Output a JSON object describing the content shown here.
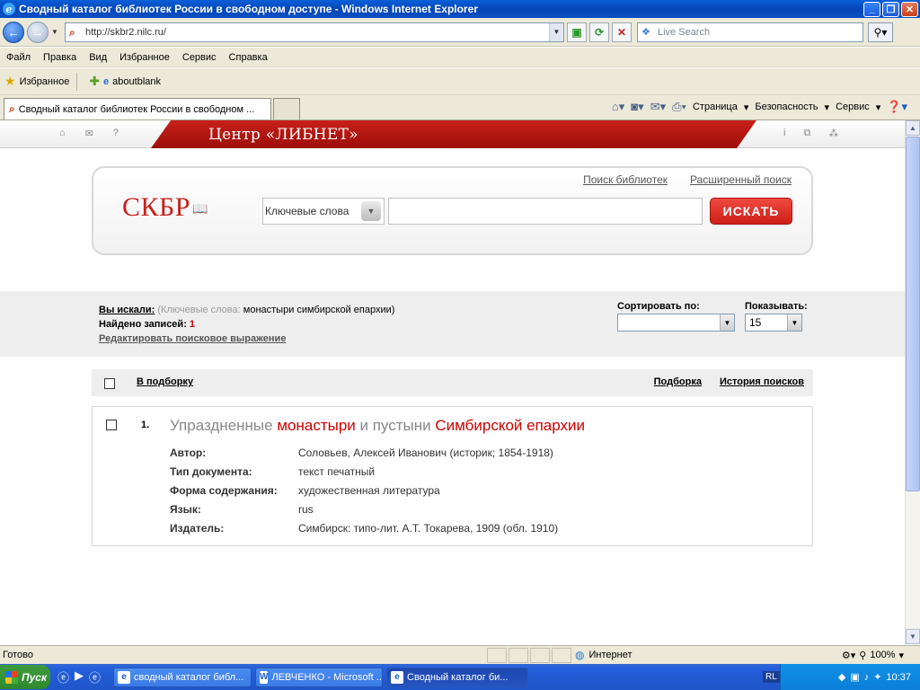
{
  "window": {
    "title": "Сводный каталог библиотек России в свободном доступе - Windows Internet Explorer"
  },
  "address": {
    "url": "http://skbr2.nilc.ru/",
    "search_placeholder": "Live Search"
  },
  "menu": [
    "Файл",
    "Правка",
    "Вид",
    "Избранное",
    "Сервис",
    "Справка"
  ],
  "favorites": {
    "label": "Избранное",
    "link": "aboutblank"
  },
  "tabs": {
    "active": "Сводный каталог библиотек России в свободном ...",
    "commands": [
      "Страница",
      "Безопасность",
      "Сервис"
    ]
  },
  "site": {
    "header_name": "Центр «ЛИБНЕТ»",
    "logo": "СКБР",
    "links": [
      "Поиск библиотек",
      "Расширенный поиск"
    ],
    "search": {
      "field_type": "Ключевые слова",
      "query": "",
      "button": "ИСКАТЬ"
    }
  },
  "summary": {
    "searched_label": "Вы искали:",
    "searched_field": "(Ключевые слова:",
    "searched_query": "монастыри симбирской епархии)",
    "found_label": "Найдено записей:",
    "found_count": "1",
    "edit_link": "Редактировать поисковое выражение",
    "sort_label": "Сортировать по:",
    "sort_value": "",
    "show_label": "Показывать:",
    "show_value": "15"
  },
  "list_header": {
    "add_selection": "В подборку",
    "selection": "Подборка",
    "history": "История поисков"
  },
  "results": [
    {
      "number": "1.",
      "title_parts": [
        "Упраздненные ",
        "монастыри",
        " и пустыни ",
        "Симбирской епархии"
      ],
      "fields": [
        {
          "label": "Автор:",
          "value": "Соловьев, Алексей Иванович (историк; 1854-1918)"
        },
        {
          "label": "Тип документа:",
          "value": "текст печатный"
        },
        {
          "label": "Форма содержания:",
          "value": "художественная литература"
        },
        {
          "label": "Язык:",
          "value": "rus"
        },
        {
          "label": "Издатель:",
          "value": "Симбирск: типо-лит. А.Т. Токарева, 1909 (обл. 1910)"
        }
      ]
    }
  ],
  "status": {
    "text": "Готово",
    "zone": "Интернет",
    "zoom": "100%"
  },
  "taskbar": {
    "start": "Пуск",
    "tasks": [
      "сводный каталог библ...",
      "ЛЕВЧЕНКО - Microsoft ...",
      "Сводный каталог би..."
    ],
    "lang": "RL",
    "time": "10:37"
  },
  "colors": {
    "brand_red": "#c8201a",
    "highlight_red": "#cc0000"
  }
}
